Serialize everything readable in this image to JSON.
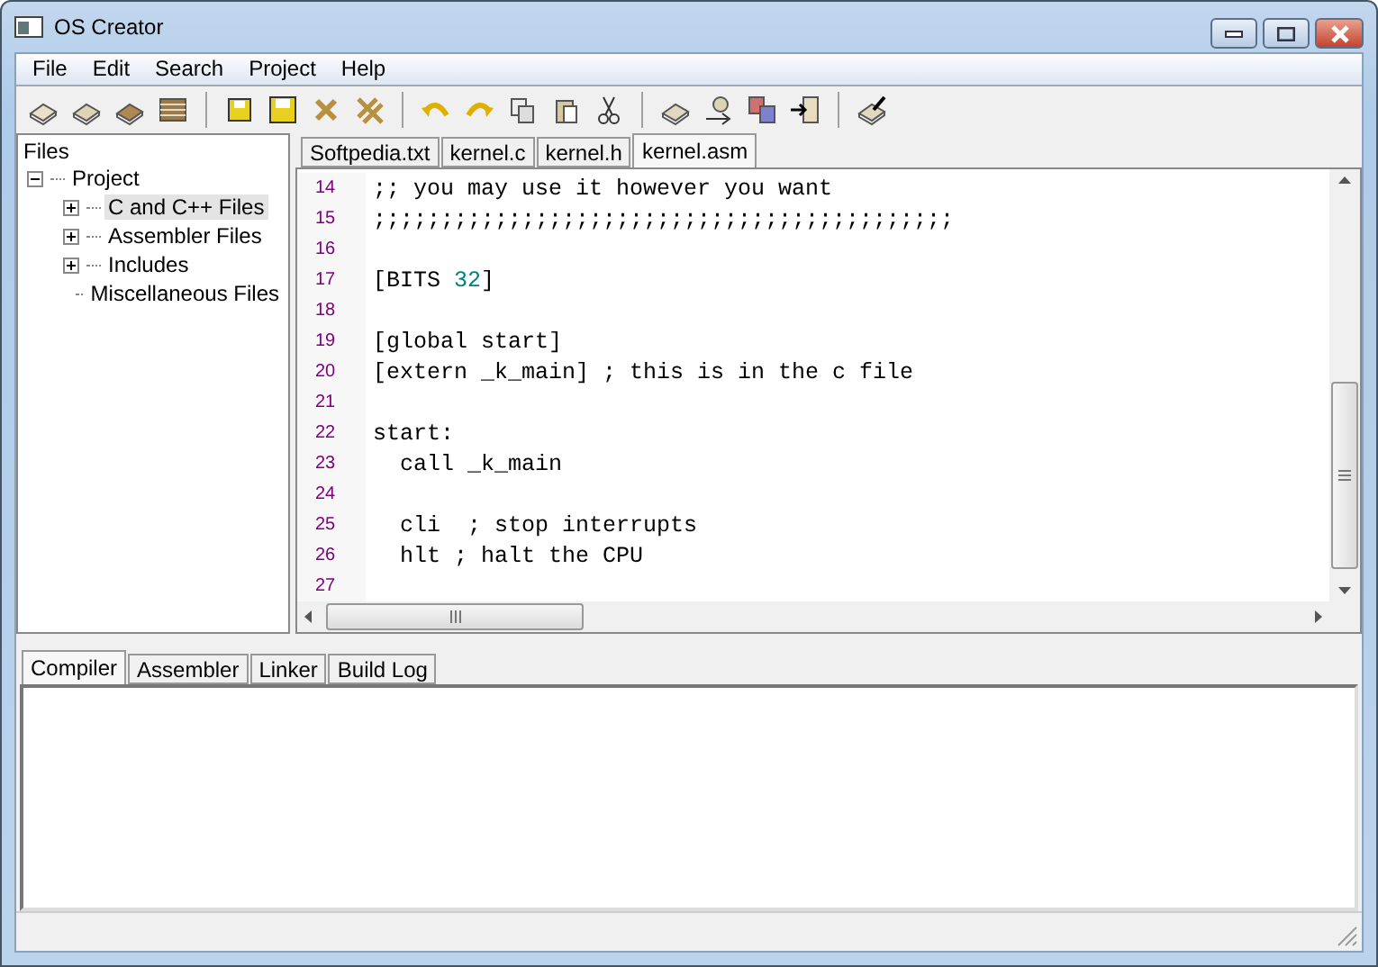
{
  "window": {
    "title": "OS Creator"
  },
  "menu": [
    "File",
    "Edit",
    "Search",
    "Project",
    "Help"
  ],
  "tree": {
    "title": "Files",
    "items": [
      {
        "label": "Project",
        "expanded": true,
        "selected": false,
        "children": [
          {
            "label": "C and C++ Files",
            "expanded": false,
            "selected": true
          },
          {
            "label": "Assembler Files",
            "expanded": false,
            "selected": false
          },
          {
            "label": "Includes",
            "expanded": false,
            "selected": false
          },
          {
            "label": "Miscellaneous Files",
            "selected": false
          }
        ]
      }
    ]
  },
  "editor_tabs": [
    {
      "label": "Softpedia.txt",
      "selected": false
    },
    {
      "label": "kernel.c",
      "selected": false
    },
    {
      "label": "kernel.h",
      "selected": false
    },
    {
      "label": "kernel.asm",
      "selected": true
    }
  ],
  "code_lines": [
    {
      "number": "14",
      "segments": [
        {
          "text": ";; you may use it however you want",
          "kind": "plain"
        }
      ]
    },
    {
      "number": "15",
      "segments": [
        {
          "text": ";;;;;;;;;;;;;;;;;;;;;;;;;;;;;;;;;;;;;;;;;;;",
          "kind": "plain"
        }
      ]
    },
    {
      "number": "16"
    },
    {
      "number": "17",
      "segments": [
        {
          "text": "[BITS ",
          "kind": "plain"
        },
        {
          "text": "32",
          "kind": "number"
        },
        {
          "text": "]",
          "kind": "plain"
        }
      ]
    },
    {
      "number": "18"
    },
    {
      "number": "19",
      "segments": [
        {
          "text": "[global start]",
          "kind": "plain"
        }
      ]
    },
    {
      "number": "20",
      "segments": [
        {
          "text": "[extern _k_main] ; this is in the c file",
          "kind": "plain"
        }
      ]
    },
    {
      "number": "21"
    },
    {
      "number": "22",
      "segments": [
        {
          "text": "start:",
          "kind": "plain"
        }
      ]
    },
    {
      "number": "23",
      "segments": [
        {
          "text": "  call _k_main",
          "kind": "plain"
        }
      ]
    },
    {
      "number": "24"
    },
    {
      "number": "25",
      "segments": [
        {
          "text": "  cli  ; stop interrupts",
          "kind": "plain"
        }
      ]
    },
    {
      "number": "26",
      "segments": [
        {
          "text": "  hlt ; halt the CPU",
          "kind": "plain"
        }
      ]
    },
    {
      "number": "27"
    }
  ],
  "output_tabs": [
    {
      "label": "Compiler",
      "selected": true
    },
    {
      "label": "Assembler",
      "selected": false
    },
    {
      "label": "Linker",
      "selected": false
    },
    {
      "label": "Build Log",
      "selected": false
    }
  ]
}
